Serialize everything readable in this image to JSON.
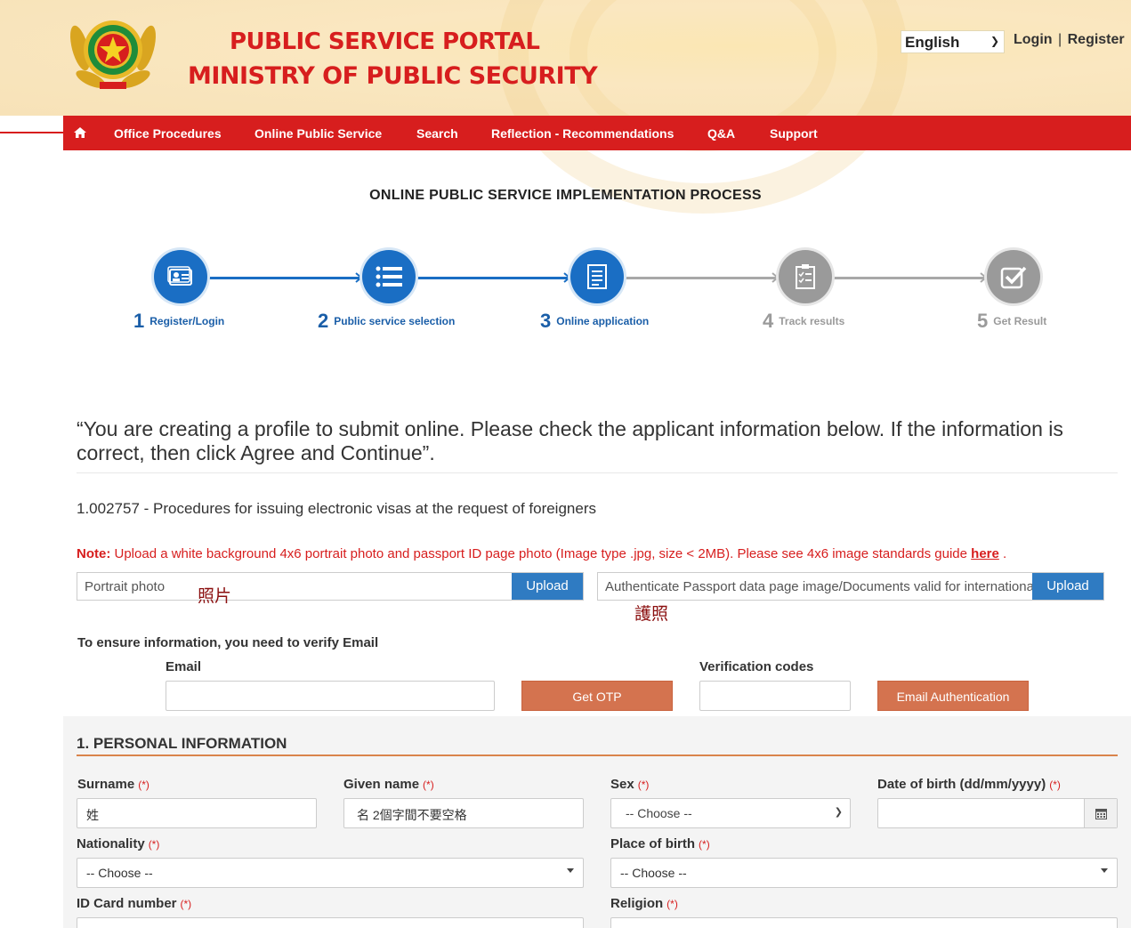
{
  "header": {
    "title_line1": "PUBLIC SERVICE PORTAL",
    "title_line2": "MINISTRY OF PUBLIC SECURITY",
    "language": "English",
    "login": "Login",
    "separator": "|",
    "register": "Register"
  },
  "nav": {
    "items": [
      "Office Procedures",
      "Online Public Service",
      "Search",
      "Reflection - Recommendations",
      "Q&A",
      "Support"
    ]
  },
  "process": {
    "title": "ONLINE PUBLIC SERVICE IMPLEMENTATION PROCESS",
    "steps": [
      {
        "num": "1",
        "label": "Register/Login",
        "icon": "id-card-icon",
        "state": "done"
      },
      {
        "num": "2",
        "label": "Public service selection",
        "icon": "list-icon",
        "state": "done"
      },
      {
        "num": "3",
        "label": "Online application",
        "icon": "document-icon",
        "state": "current"
      },
      {
        "num": "4",
        "label": "Track results",
        "icon": "checklist-icon",
        "state": "pending"
      },
      {
        "num": "5",
        "label": "Get Result",
        "icon": "check-square-icon",
        "state": "pending"
      }
    ]
  },
  "intro": "“You are creating a profile to submit online. Please check the applicant information below. If the information is correct, then click Agree and Continue”.",
  "procedure": "1.002757 - Procedures for issuing electronic visas at the request of foreigners",
  "note": {
    "prefix": "Note:",
    "text": " Upload a white background 4x6 portrait photo and passport ID page photo (Image type .jpg, size < 2MB). Please see 4x6 image standards guide ",
    "link": "here",
    "suffix": " ."
  },
  "uploads": {
    "portrait_placeholder": "Portrait photo",
    "passport_placeholder": "Authenticate Passport data page image/Documents valid for international travel",
    "upload_label": "Upload",
    "portrait_annotation": "照片",
    "passport_annotation": "護照"
  },
  "verify": {
    "heading": "To ensure information, you need to verify Email",
    "email_label": "Email",
    "email_value": "",
    "otp_button": "Get OTP",
    "code_label": "Verification codes",
    "code_value": "",
    "auth_button": "Email Authentication"
  },
  "personal": {
    "title": "1. PERSONAL INFORMATION",
    "required_mark": "(*)",
    "surname_label": "Surname",
    "surname_value": "姓",
    "given_label": "Given name",
    "given_value": "名  2個字間不要空格",
    "sex_label": "Sex",
    "sex_value": "-- Choose --",
    "dob_label": "Date of birth (dd/mm/yyyy)",
    "dob_value": "",
    "nationality_label": "Nationality",
    "nationality_value": "-- Choose --",
    "birthplace_label": "Place of birth",
    "birthplace_value": "-- Choose --",
    "idcard_label": "ID Card number",
    "religion_label": "Religion"
  }
}
